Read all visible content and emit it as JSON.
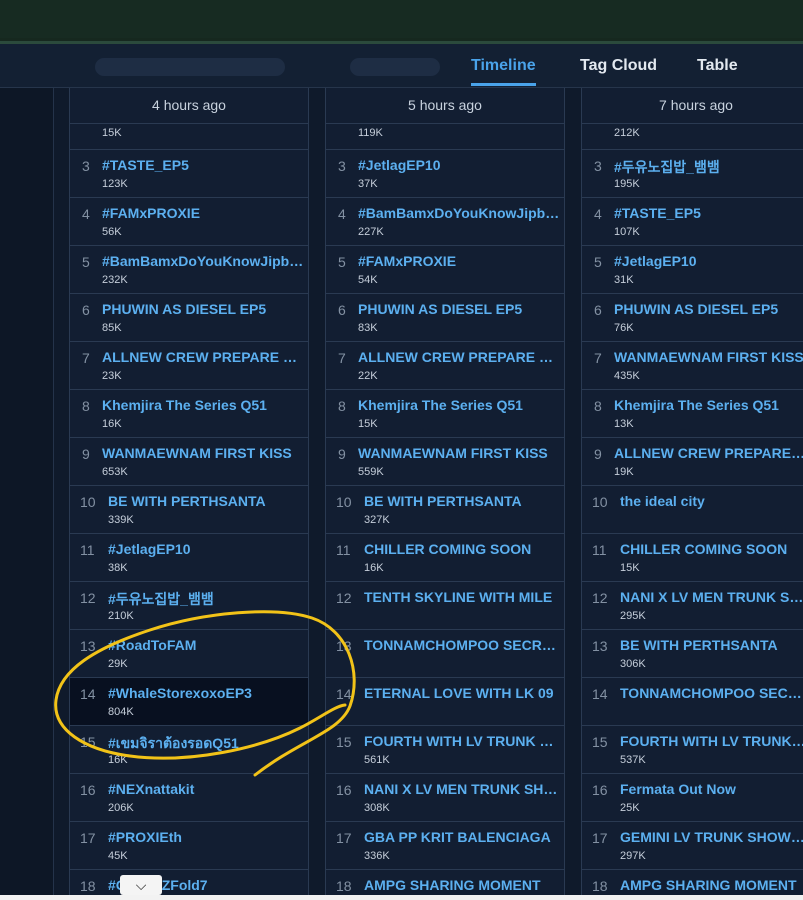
{
  "nav": {
    "tabs": [
      {
        "label": "Timeline",
        "active": true
      },
      {
        "label": "Tag Cloud",
        "active": false
      },
      {
        "label": "Table",
        "active": false
      }
    ]
  },
  "columns": [
    {
      "header": "4 hours ago",
      "rows": [
        {
          "rank": "",
          "tag": "",
          "volume": "15K"
        },
        {
          "rank": "3",
          "tag": "#TASTE_EP5",
          "volume": "123K"
        },
        {
          "rank": "4",
          "tag": "#FAMxPROXIE",
          "volume": "56K"
        },
        {
          "rank": "5",
          "tag": "#BamBamxDoYouKnowJipbom",
          "volume": "232K"
        },
        {
          "rank": "6",
          "tag": "PHUWIN AS DIESEL EP5",
          "volume": "85K"
        },
        {
          "rank": "7",
          "tag": "ALLNEW CREW PREPARE FOR THE FLIGHT",
          "volume": "23K"
        },
        {
          "rank": "8",
          "tag": "Khemjira The Series Q51",
          "volume": "16K"
        },
        {
          "rank": "9",
          "tag": "WANMAEWNAM FIRST KISS",
          "volume": "653K"
        },
        {
          "rank": "10",
          "tag": "BE WITH PERTHSANTA",
          "volume": "339K"
        },
        {
          "rank": "11",
          "tag": "#JetlagEP10",
          "volume": "38K"
        },
        {
          "rank": "12",
          "tag": "#두유노집밥_뱀뱀",
          "volume": "210K"
        },
        {
          "rank": "13",
          "tag": "#RoadToFAM",
          "volume": "29K"
        },
        {
          "rank": "14",
          "tag": "#WhaleStorexoxoEP3",
          "volume": "804K",
          "selected": true
        },
        {
          "rank": "15",
          "tag": "#เขมจิราต้องรอดQ51",
          "volume": "16K"
        },
        {
          "rank": "16",
          "tag": "#NEXnattakit",
          "volume": "206K"
        },
        {
          "rank": "17",
          "tag": "#PROXIEth",
          "volume": "45K"
        },
        {
          "rank": "18",
          "tag": "#GalaxyZFold7",
          "volume": ""
        }
      ]
    },
    {
      "header": "5 hours ago",
      "rows": [
        {
          "rank": "",
          "tag": "",
          "volume": "119K"
        },
        {
          "rank": "3",
          "tag": "#JetlagEP10",
          "volume": "37K"
        },
        {
          "rank": "4",
          "tag": "#BamBamxDoYouKnowJipbom",
          "volume": "227K"
        },
        {
          "rank": "5",
          "tag": "#FAMxPROXIE",
          "volume": "54K"
        },
        {
          "rank": "6",
          "tag": "PHUWIN AS DIESEL EP5",
          "volume": "83K"
        },
        {
          "rank": "7",
          "tag": "ALLNEW CREW PREPARE FOR THE FLIGHT",
          "volume": "22K"
        },
        {
          "rank": "8",
          "tag": "Khemjira The Series Q51",
          "volume": "15K"
        },
        {
          "rank": "9",
          "tag": "WANMAEWNAM FIRST KISS",
          "volume": "559K"
        },
        {
          "rank": "10",
          "tag": "BE WITH PERTHSANTA",
          "volume": "327K"
        },
        {
          "rank": "11",
          "tag": "CHILLER COMING SOON",
          "volume": "16K"
        },
        {
          "rank": "12",
          "tag": "TENTH SKYLINE WITH MILE",
          "volume": ""
        },
        {
          "rank": "13",
          "tag": "TONNAMCHOMPOO SECRET LOVE",
          "volume": ""
        },
        {
          "rank": "14",
          "tag": "ETERNAL LOVE WITH LK 09",
          "volume": ""
        },
        {
          "rank": "15",
          "tag": "FOURTH WITH LV TRUNK SHOW",
          "volume": "561K"
        },
        {
          "rank": "16",
          "tag": "NANI X LV MEN TRUNK SHOW",
          "volume": "308K"
        },
        {
          "rank": "17",
          "tag": "GBA PP KRIT BALENCIAGA",
          "volume": "336K"
        },
        {
          "rank": "18",
          "tag": "AMPG SHARING MOMENT",
          "volume": ""
        }
      ]
    },
    {
      "header": "7 hours ago",
      "rows": [
        {
          "rank": "",
          "tag": "",
          "volume": "212K"
        },
        {
          "rank": "3",
          "tag": "#두유노집밥_뱀뱀",
          "volume": "195K"
        },
        {
          "rank": "4",
          "tag": "#TASTE_EP5",
          "volume": "107K"
        },
        {
          "rank": "5",
          "tag": "#JetlagEP10",
          "volume": "31K"
        },
        {
          "rank": "6",
          "tag": "PHUWIN AS DIESEL EP5",
          "volume": "76K"
        },
        {
          "rank": "7",
          "tag": "WANMAEWNAM FIRST KISS",
          "volume": "435K"
        },
        {
          "rank": "8",
          "tag": "Khemjira The Series Q51",
          "volume": "13K"
        },
        {
          "rank": "9",
          "tag": "ALLNEW CREW PREPARE FOR THE FLIGHT",
          "volume": "19K"
        },
        {
          "rank": "10",
          "tag": "the ideal city",
          "volume": ""
        },
        {
          "rank": "11",
          "tag": "CHILLER COMING SOON",
          "volume": "15K"
        },
        {
          "rank": "12",
          "tag": "NANI X LV MEN TRUNK SHOW",
          "volume": "295K"
        },
        {
          "rank": "13",
          "tag": "BE WITH PERTHSANTA",
          "volume": "306K"
        },
        {
          "rank": "14",
          "tag": "TONNAMCHOMPOO SECRET LOVE",
          "volume": ""
        },
        {
          "rank": "15",
          "tag": "FOURTH WITH LV TRUNK SHOW",
          "volume": "537K"
        },
        {
          "rank": "16",
          "tag": "Fermata Out Now",
          "volume": "25K"
        },
        {
          "rank": "17",
          "tag": "GEMINI LV TRUNK SHOW BKK",
          "volume": "297K"
        },
        {
          "rank": "18",
          "tag": "AMPG SHARING MOMENT",
          "volume": ""
        }
      ]
    }
  ],
  "colors": {
    "tag_link": "#5cb0f0",
    "active_tab": "#4aa3ea",
    "annotation": "#f2c318",
    "background": "#121e32"
  },
  "icons": {
    "scroll": "chevron-down-icon"
  }
}
